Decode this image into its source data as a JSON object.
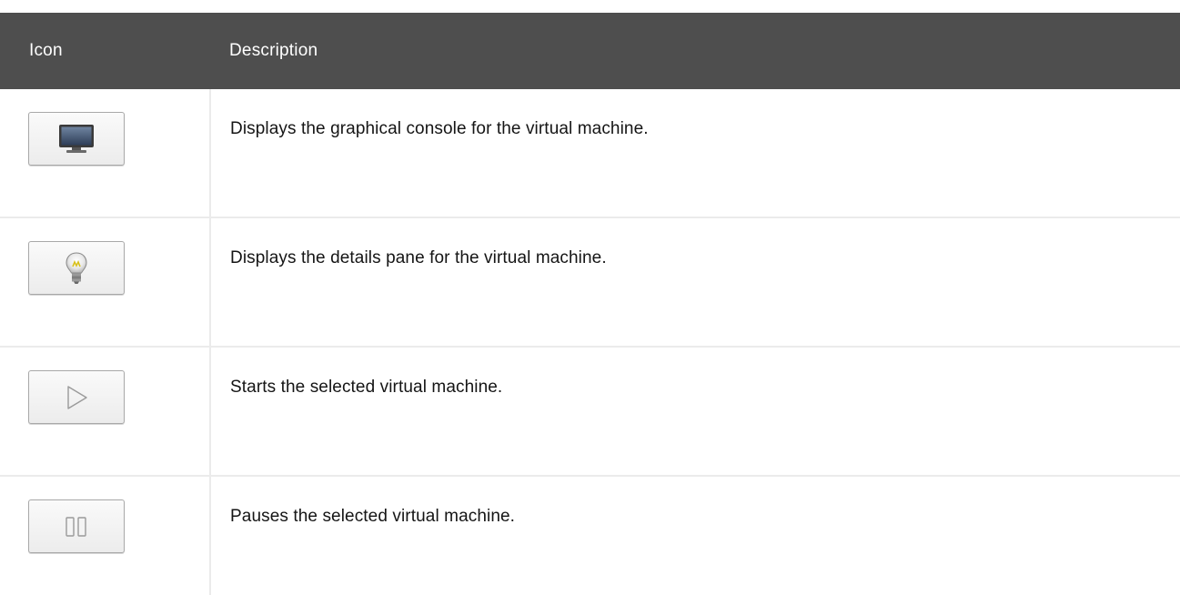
{
  "table": {
    "header": {
      "icon": "Icon",
      "description": "Description"
    },
    "rows": [
      {
        "icon": "monitor-icon",
        "description": "Displays the graphical console for the virtual machine."
      },
      {
        "icon": "lightbulb-icon",
        "description": "Displays the details pane for the virtual machine."
      },
      {
        "icon": "play-icon",
        "description": "Starts the selected virtual machine."
      },
      {
        "icon": "pause-icon",
        "description": "Pauses the selected virtual machine."
      }
    ]
  },
  "colors": {
    "header_background": "#4e4e4e",
    "header_text": "#ffffff",
    "body_text": "#151515",
    "row_border": "#ebebeb"
  }
}
